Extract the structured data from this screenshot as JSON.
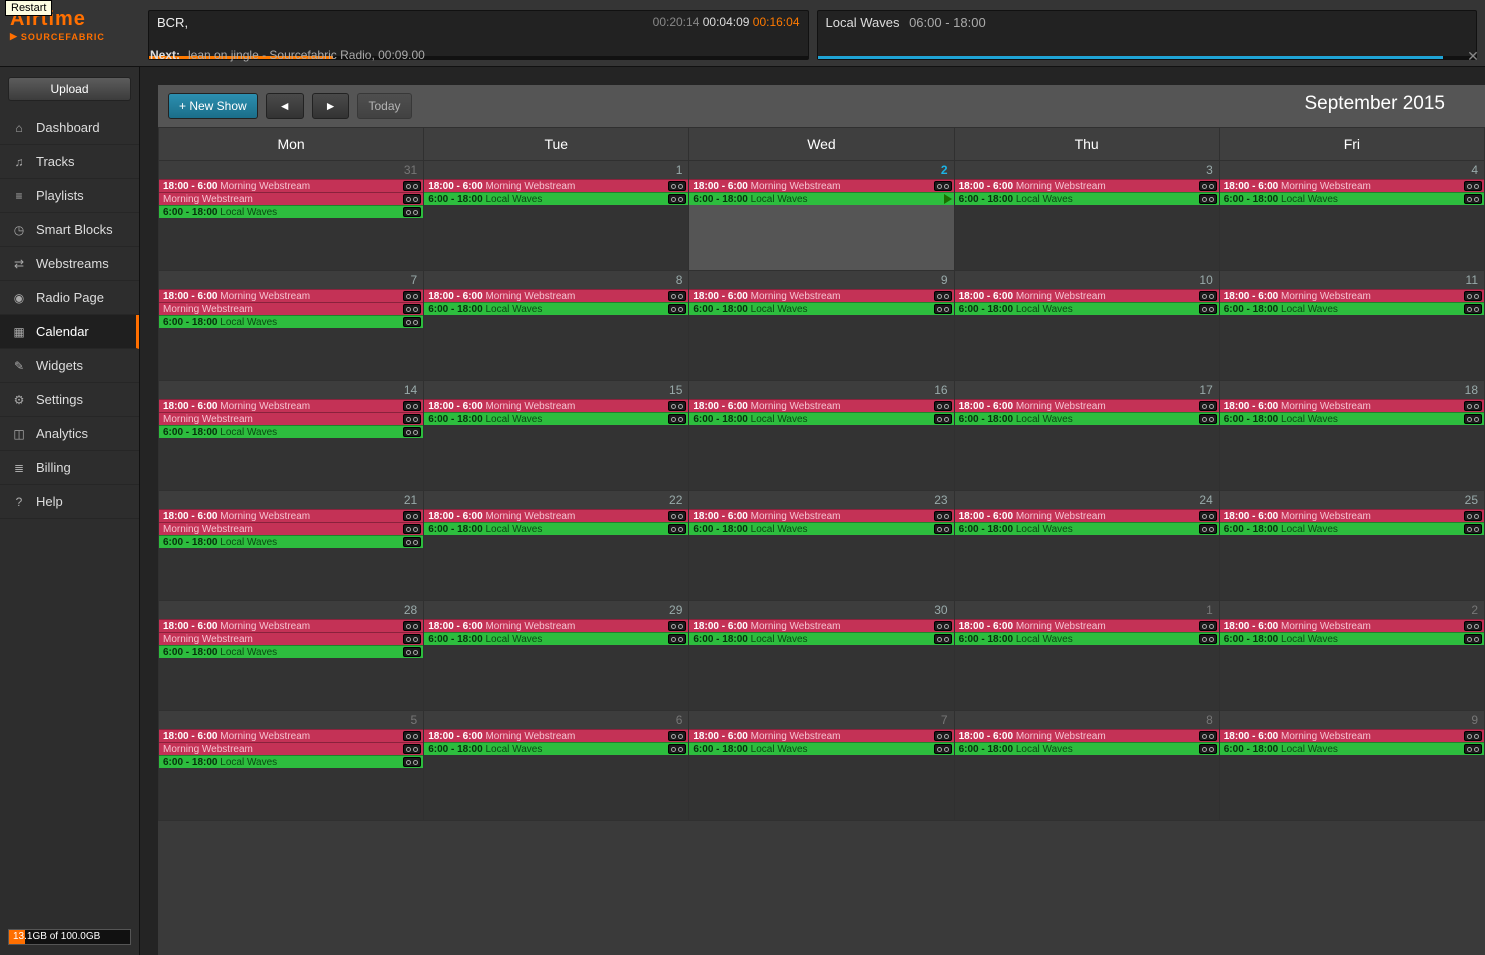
{
  "tooltip": "Restart",
  "logo": {
    "line1": "Airtime",
    "line2": "SOURCEFABRIC"
  },
  "nowplaying": {
    "track": "BCR,",
    "elapsed": "00:20:14",
    "total": "00:04:09",
    "remaining": "00:16:04",
    "progress_pct": 28,
    "show_name": "Local Waves",
    "show_time": "06:00 - 18:00",
    "show_progress_pct": 95,
    "next_label": "Next:",
    "next_text": "lean on jingle - Sourcefabric Radio, 00:09.00"
  },
  "sidebar": {
    "upload": "Upload",
    "items": [
      {
        "icon": "⌂",
        "label": "Dashboard"
      },
      {
        "icon": "♫",
        "label": "Tracks"
      },
      {
        "icon": "≡",
        "label": "Playlists"
      },
      {
        "icon": "◷",
        "label": "Smart Blocks"
      },
      {
        "icon": "⇄",
        "label": "Webstreams"
      },
      {
        "icon": "◉",
        "label": "Radio Page"
      },
      {
        "icon": "▦",
        "label": "Calendar",
        "active": true
      },
      {
        "icon": "✎",
        "label": "Widgets"
      },
      {
        "icon": "⚙",
        "label": "Settings"
      },
      {
        "icon": "◫",
        "label": "Analytics"
      },
      {
        "icon": "≣",
        "label": "Billing"
      },
      {
        "icon": "?",
        "label": "Help"
      }
    ],
    "storage": "13.1GB of 100.0GB"
  },
  "toolbar": {
    "new_show": "+ New Show",
    "prev": "◄",
    "next": "►",
    "today": "Today"
  },
  "calendar": {
    "title": "September 2015",
    "headers": [
      "Mon",
      "Tue",
      "Wed",
      "Thu",
      "Fri"
    ],
    "event_morning_time": "18:00 - 6:00",
    "event_morning_name": "Morning Webstream",
    "event_local_time": "6:00 - 18:00",
    "event_local_name": "Local Waves",
    "weeks": [
      [
        {
          "n": "31",
          "other": true,
          "mon": true
        },
        {
          "n": "1"
        },
        {
          "n": "2",
          "today": true
        },
        {
          "n": "3"
        },
        {
          "n": "4"
        }
      ],
      [
        {
          "n": "7",
          "mon": true
        },
        {
          "n": "8"
        },
        {
          "n": "9"
        },
        {
          "n": "10"
        },
        {
          "n": "11"
        }
      ],
      [
        {
          "n": "14",
          "mon": true
        },
        {
          "n": "15"
        },
        {
          "n": "16"
        },
        {
          "n": "17"
        },
        {
          "n": "18"
        }
      ],
      [
        {
          "n": "21",
          "mon": true
        },
        {
          "n": "22"
        },
        {
          "n": "23"
        },
        {
          "n": "24"
        },
        {
          "n": "25"
        }
      ],
      [
        {
          "n": "28",
          "mon": true
        },
        {
          "n": "29"
        },
        {
          "n": "30"
        },
        {
          "n": "1",
          "other": true
        },
        {
          "n": "2",
          "other": true
        }
      ],
      [
        {
          "n": "5",
          "other": true,
          "mon": true
        },
        {
          "n": "6",
          "other": true
        },
        {
          "n": "7",
          "other": true
        },
        {
          "n": "8",
          "other": true
        },
        {
          "n": "9",
          "other": true
        }
      ]
    ]
  }
}
